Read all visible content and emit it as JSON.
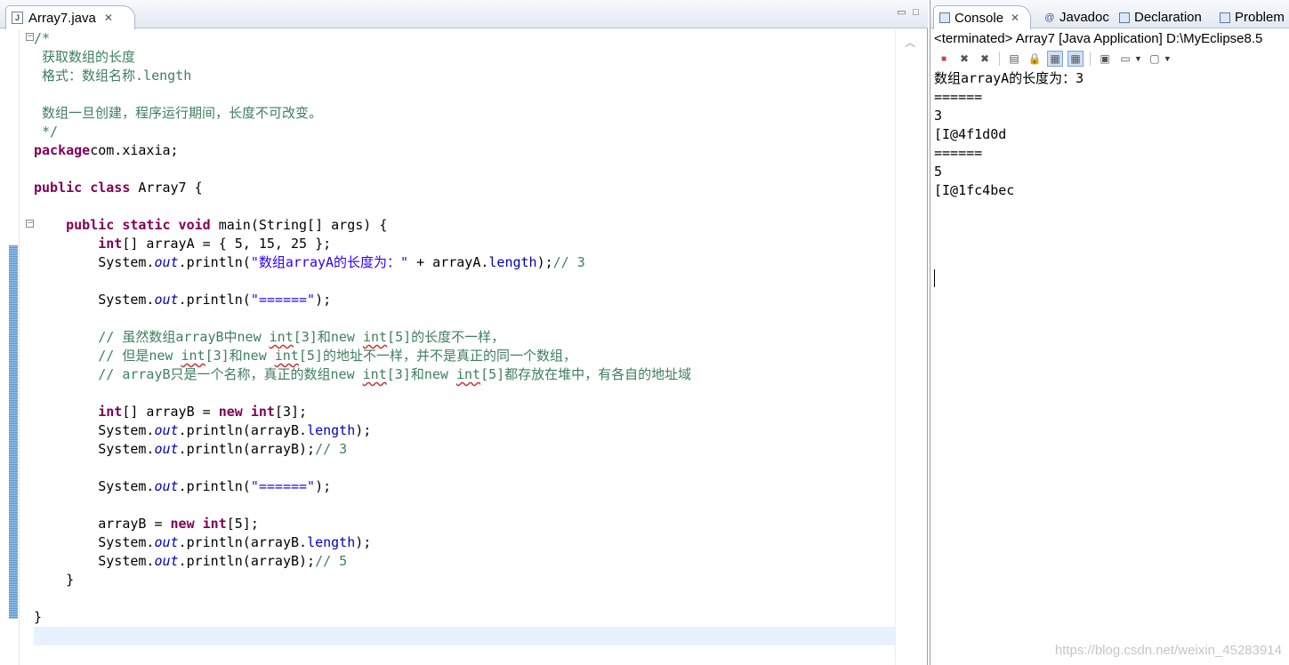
{
  "editor": {
    "tab_label": "Array7.java",
    "tab_close": "✕",
    "minimize": "▭",
    "maximize": "□",
    "lines": [
      [
        [
          "cm",
          "/*"
        ]
      ],
      [
        [
          "cm",
          " 获取数组的长度"
        ]
      ],
      [
        [
          "cm",
          " 格式：数组名称.length"
        ]
      ],
      [
        [
          "cm",
          ""
        ]
      ],
      [
        [
          "cm",
          " 数组一旦创建，程序运行期间，长度不可改变。"
        ]
      ],
      [
        [
          "cm",
          " */"
        ]
      ],
      [
        [
          "kw",
          "package"
        ],
        [
          "",
          "com.xiaxia;"
        ]
      ],
      [
        [
          "",
          ""
        ]
      ],
      [
        [
          "kw",
          "public class"
        ],
        [
          "",
          " Array7 {"
        ]
      ],
      [
        [
          "",
          ""
        ]
      ],
      [
        [
          "",
          "    "
        ],
        [
          "kw",
          "public static void"
        ],
        [
          "",
          " main(String[] args) {"
        ]
      ],
      [
        [
          "",
          "        "
        ],
        [
          "kw",
          "int"
        ],
        [
          "",
          "[] arrayA = { 5, 15, 25 };"
        ]
      ],
      [
        [
          "",
          "        System."
        ],
        [
          "it",
          "out"
        ],
        [
          "",
          ".println("
        ],
        [
          "st",
          "\"数组arrayA的长度为：\""
        ],
        [
          "",
          " + arrayA."
        ],
        [
          "fd",
          "length"
        ],
        [
          "",
          ");"
        ],
        [
          "cm",
          "// 3"
        ]
      ],
      [
        [
          "",
          ""
        ]
      ],
      [
        [
          "",
          "        System."
        ],
        [
          "it",
          "out"
        ],
        [
          "",
          ".println("
        ],
        [
          "st",
          "\"======\""
        ],
        [
          "",
          ");"
        ]
      ],
      [
        [
          "",
          ""
        ]
      ],
      [
        [
          "cm",
          "        // 虽然数组arrayB中new "
        ],
        [
          "cm sq",
          "int"
        ],
        [
          "cm",
          "[3]和new "
        ],
        [
          "cm sq",
          "int"
        ],
        [
          "cm",
          "[5]的长度不一样，"
        ]
      ],
      [
        [
          "cm",
          "        // 但是new "
        ],
        [
          "cm sq",
          "int"
        ],
        [
          "cm",
          "[3]和new "
        ],
        [
          "cm sq",
          "int"
        ],
        [
          "cm",
          "[5]的地址不一样，并不是真正的同一个数组，"
        ]
      ],
      [
        [
          "cm",
          "        // arrayB只是一个名称，真正的数组new "
        ],
        [
          "cm sq",
          "int"
        ],
        [
          "cm",
          "[3]和new "
        ],
        [
          "cm sq",
          "int"
        ],
        [
          "cm",
          "[5]都存放在堆中，有各自的地址域"
        ]
      ],
      [
        [
          "",
          ""
        ]
      ],
      [
        [
          "",
          "        "
        ],
        [
          "kw",
          "int"
        ],
        [
          "",
          "[] arrayB = "
        ],
        [
          "kw",
          "new"
        ],
        [
          "",
          ""
        ],
        [
          "kw",
          " int"
        ],
        [
          "",
          "[3];"
        ]
      ],
      [
        [
          "",
          "        System."
        ],
        [
          "it",
          "out"
        ],
        [
          "",
          ".println(arrayB."
        ],
        [
          "fd",
          "length"
        ],
        [
          "",
          ");"
        ]
      ],
      [
        [
          "",
          "        System."
        ],
        [
          "it",
          "out"
        ],
        [
          "",
          ".println(arrayB);"
        ],
        [
          "cm",
          "// 3"
        ]
      ],
      [
        [
          "",
          ""
        ]
      ],
      [
        [
          "",
          "        System."
        ],
        [
          "it",
          "out"
        ],
        [
          "",
          ".println("
        ],
        [
          "st",
          "\"======\""
        ],
        [
          "",
          ");"
        ]
      ],
      [
        [
          "",
          ""
        ]
      ],
      [
        [
          "",
          "        arrayB = "
        ],
        [
          "kw",
          "new"
        ],
        [
          "kw",
          " int"
        ],
        [
          "",
          "[5];"
        ]
      ],
      [
        [
          "",
          "        System."
        ],
        [
          "it",
          "out"
        ],
        [
          "",
          ".println(arrayB."
        ],
        [
          "fd",
          "length"
        ],
        [
          "",
          ");"
        ]
      ],
      [
        [
          "",
          "        System."
        ],
        [
          "it",
          "out"
        ],
        [
          "",
          ".println(arrayB);"
        ],
        [
          "cm",
          "// 5"
        ]
      ],
      [
        [
          "",
          "    }"
        ]
      ],
      [
        [
          "",
          ""
        ]
      ],
      [
        [
          "",
          "}"
        ]
      ],
      [
        [
          "",
          ""
        ]
      ]
    ]
  },
  "console": {
    "tabs": [
      {
        "label": "Console",
        "icon": "console-icon",
        "active": true
      },
      {
        "label": "Javadoc",
        "icon": "javadoc-icon",
        "active": false
      },
      {
        "label": "Declaration",
        "icon": "declaration-icon",
        "active": false
      },
      {
        "label": "Problem",
        "icon": "problems-icon",
        "active": false
      }
    ],
    "tab_close": "✕",
    "status": "<terminated> Array7 [Java Application] D:\\MyEclipse8.5",
    "output": [
      "数组arrayA的长度为：3",
      "======",
      "3",
      "[I@4f1d0d",
      "======",
      "5",
      "[I@1fc4bec"
    ]
  },
  "watermark": "https://blog.csdn.net/weixin_45283914",
  "colors": {
    "keyword": "#7f0055",
    "comment": "#3f7f5f",
    "string": "#2a00ff",
    "field": "#0000c0",
    "current_line": "#e8f2fe"
  }
}
